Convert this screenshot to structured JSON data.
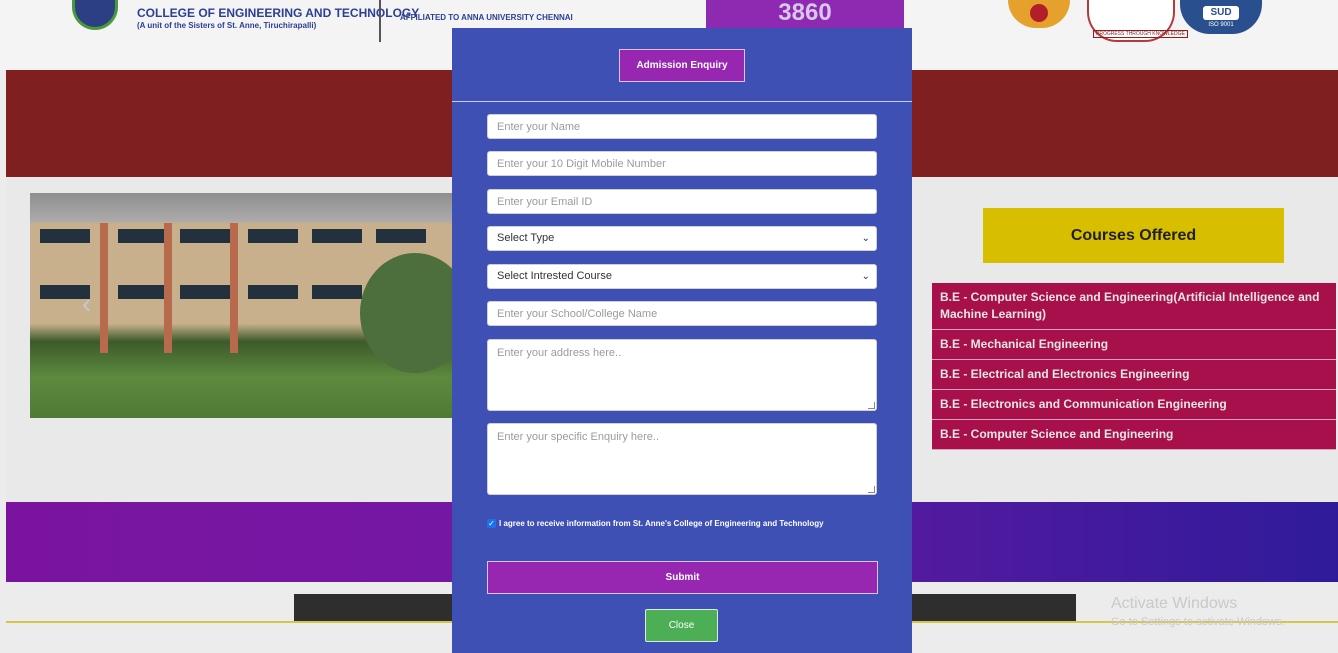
{
  "header": {
    "college_name": "COLLEGE OF ENGINEERING AND TECHNOLOGY",
    "college_sub": "(A unit of the Sisters of St. Anne, Tiruchirapalli)",
    "affiliation": "AFFILIATED TO ANNA UNIVERSITY CHENNAI",
    "counter": "3860",
    "badge_ptk": "PROGRESS THROUGH KNOWLEDGE",
    "badge_sud": "SUD",
    "badge_iso": "ISO 9001"
  },
  "courses": {
    "heading": "Courses Offered",
    "items": [
      "B.E - Computer Science and Engineering(Artificial Intelligence and Machine Learning)",
      "B.E - Mechanical Engineering",
      "B.E - Electrical and Electronics Engineering",
      "B.E - Electronics and Communication Engineering",
      "B.E - Computer Science and Engineering"
    ]
  },
  "slider": {
    "prev_icon": "‹"
  },
  "modal": {
    "title": "Admission Enquiry",
    "name_placeholder": "Enter your Name",
    "mobile_placeholder": "Enter your 10 Digit Mobile Number",
    "email_placeholder": "Enter your Email ID",
    "type_select": "Select Type",
    "course_select": "Select Intrested Course",
    "school_placeholder": "Enter your School/College Name",
    "address_placeholder": "Enter your address here..",
    "enquiry_placeholder": "Enter your specific Enquiry here..",
    "agree_text": "I agree to receive information from St. Anne's College of Engineering and Technology",
    "agree_checked": true,
    "submit_label": "Submit",
    "close_label": "Close"
  },
  "watermark": {
    "title": "Activate Windows",
    "subtitle": "Go to Settings to activate Windows."
  },
  "colors": {
    "modal_bg": "#3f50b5",
    "accent_purple": "#9727b1",
    "close_green": "#4cae55",
    "course_bg": "#a8104c",
    "course_head_bg": "#d7bf00"
  }
}
